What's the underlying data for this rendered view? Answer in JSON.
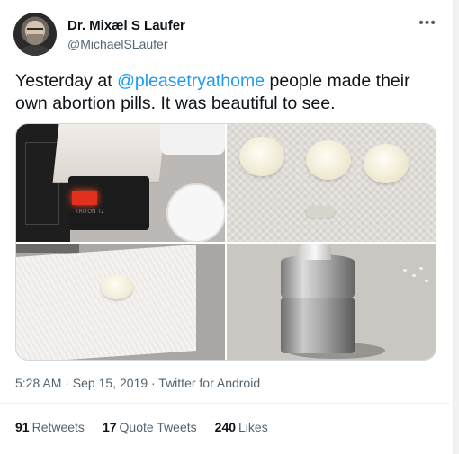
{
  "tweet": {
    "author": {
      "display_name": "Dr. Mixæl S Laufer",
      "handle": "@MichaelSLaufer"
    },
    "more_icon": "more-horizontal-icon",
    "text": {
      "prefix": "Yesterday at ",
      "mention": "@pleasetryathome",
      "suffix": " people made their own abortion pills. It was beautiful to see."
    },
    "media": {
      "scale_label": "TRITON T2"
    },
    "meta": "5:28 AM · Sep 15, 2019 · Twitter for Android",
    "stats": {
      "retweets_count": "91",
      "retweets_label": "Retweets",
      "quotes_count": "17",
      "quotes_label": "Quote Tweets",
      "likes_count": "240",
      "likes_label": "Likes"
    }
  },
  "colors": {
    "link": "#1d9bf0",
    "secondary_text": "#536471",
    "primary_text": "#0f1419"
  }
}
